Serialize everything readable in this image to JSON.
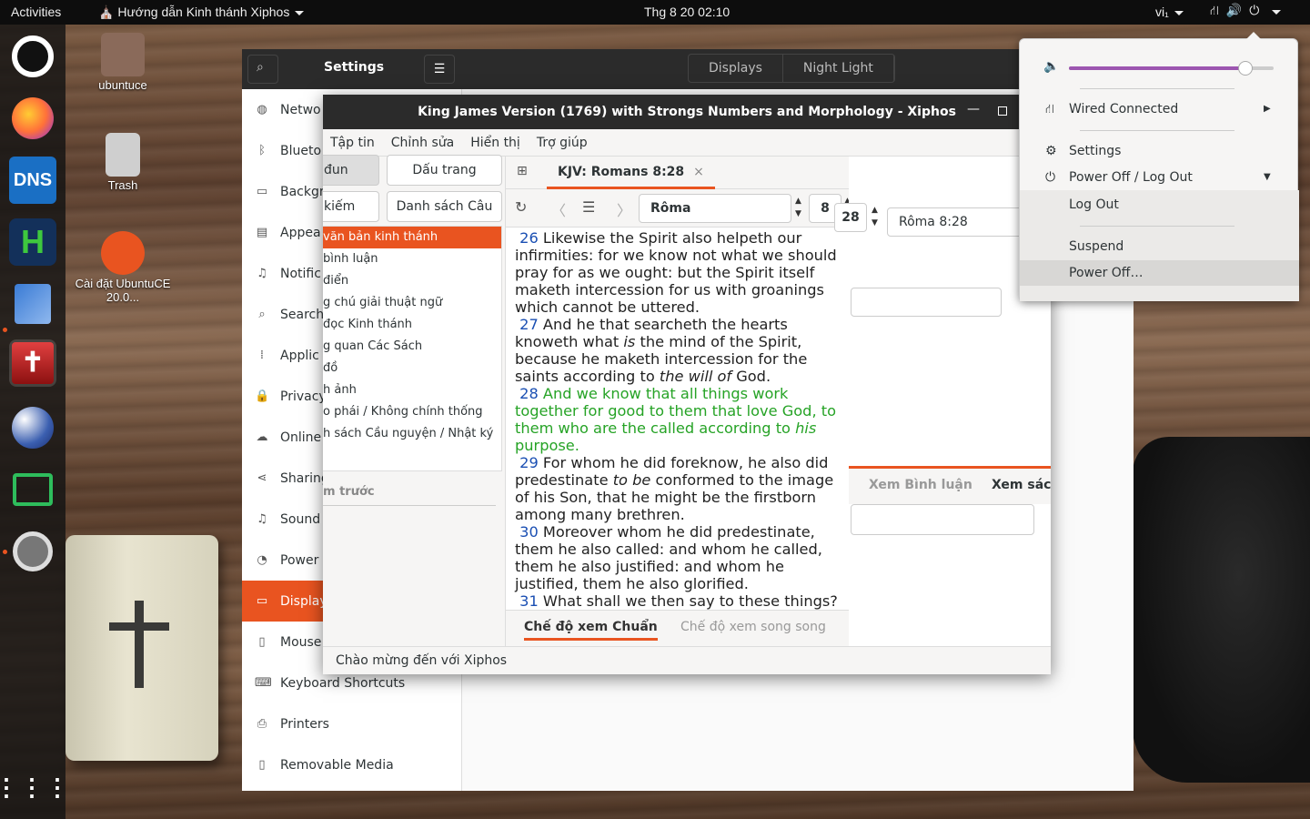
{
  "topbar": {
    "activities": "Activities",
    "app_menu": "Hướng dẫn Kinh thánh Xiphos",
    "clock": "Thg 8 20  02:10",
    "lang": "vi₁"
  },
  "desktop": {
    "icons": [
      {
        "label": "ubuntuce"
      },
      {
        "label": "Trash"
      },
      {
        "label": "Cài đặt UbuntuCE 20.0..."
      }
    ]
  },
  "dock": {
    "items": [
      "ubuntu-icon",
      "firefox-icon",
      "dns-icon",
      "h-icon",
      "installer-icon",
      "xiphos-icon",
      "globe-icon",
      "screen-icon",
      "settings-icon",
      "apps-grid-icon"
    ],
    "dns_label": "DNS",
    "h_label": "H"
  },
  "settings": {
    "title": "Settings",
    "tabs": [
      "Displays",
      "Night Light"
    ],
    "sidebar": [
      {
        "label": "Netwo",
        "icon": "network-icon"
      },
      {
        "label": "Blueto",
        "icon": "bluetooth-icon"
      },
      {
        "label": "Backgr",
        "icon": "background-icon"
      },
      {
        "label": "Appea",
        "icon": "appearance-icon"
      },
      {
        "label": "Notific",
        "icon": "bell-icon"
      },
      {
        "label": "Search",
        "icon": "search-icon"
      },
      {
        "label": "Applic",
        "icon": "apps-icon"
      },
      {
        "label": "Privacy",
        "icon": "lock-icon"
      },
      {
        "label": "Online",
        "icon": "cloud-icon"
      },
      {
        "label": "Sharing",
        "icon": "share-icon"
      },
      {
        "label": "Sound",
        "icon": "music-icon"
      },
      {
        "label": "Power",
        "icon": "power-icon"
      },
      {
        "label": "Display",
        "icon": "display-icon"
      },
      {
        "label": "Mouse",
        "icon": "mouse-icon"
      },
      {
        "label": "Keyboard Shortcuts",
        "icon": "keyboard-icon"
      },
      {
        "label": "Printers",
        "icon": "printer-icon"
      },
      {
        "label": "Removable Media",
        "icon": "media-icon"
      }
    ]
  },
  "xiphos": {
    "title": "King James Version (1769) with Strongs Numbers and Morphology - Xiphos",
    "menu": [
      "Tập tin",
      "Chỉnh sửa",
      "Hiển thị",
      "Trợ giúp"
    ],
    "left": {
      "btn1": "đun",
      "btn2": "Dấu trang",
      "btn3": "kiếm",
      "btn4": "Danh sách Câu",
      "tree": [
        "văn bản kinh thánh",
        "bình luận",
        "điển",
        "g chú giải thuật ngữ",
        " đọc Kinh thánh",
        "g quan Các Sách",
        " đồ",
        "h ảnh",
        "o phái / Không chính thống",
        "h sách Cầu nguyện / Nhật ký"
      ],
      "preview": "m trước"
    },
    "tab_label": "KJV: Romans 8:28",
    "nav": {
      "book": "Rôma",
      "chapter": "8",
      "verse": "28",
      "ref": "Rôma 8:28"
    },
    "verses": [
      {
        "num": "26",
        "pre": "Likewise the Spirit also helpeth our infirmities: for we know not what we should pray for as we ought: but the Spirit itself maketh intercession for us with groanings which cannot be uttered.",
        "highlight": false
      },
      {
        "num": "27",
        "pre": "And he that searcheth the hearts knoweth what ",
        "em": "is",
        "post": " the mind of the Spirit, because he maketh intercession for the saints according to ",
        "em2": "the will of",
        "post2": " God.",
        "highlight": false
      },
      {
        "num": "28",
        "pre": "And we know that all things work together for good to them that love God, to them who are the called according to ",
        "em": "his",
        "post": " purpose.",
        "highlight": true
      },
      {
        "num": "29",
        "pre": "For whom he did foreknow, he also did predestinate ",
        "em": "to be",
        "post": " conformed to the image of his Son, that he might be the firstborn among many brethren.",
        "highlight": false
      },
      {
        "num": "30",
        "pre": "Moreover whom he did predestinate, them he also called: and whom he called, them he also justified: and whom he justified, them he also glorified.",
        "highlight": false
      },
      {
        "num": "31",
        "pre": "What shall we then say to these things?",
        "highlight": false
      }
    ],
    "view_tabs": [
      "Chế độ xem Chuẩn",
      "Chế độ xem song song"
    ],
    "right_tabs": [
      "Xem Bình luận",
      "Xem sách"
    ],
    "status": "Chào mừng đến với Xiphos"
  },
  "popover": {
    "volume_level": 0.86,
    "wired": "Wired Connected",
    "settings": "Settings",
    "power_menu": "Power Off / Log Out",
    "logout": "Log Out",
    "suspend": "Suspend",
    "poweroff": "Power Off…"
  },
  "colors": {
    "accent": "#e95420",
    "slider": "#9c56b0",
    "verse_num": "#1a4fb3",
    "highlight": "#26a326"
  }
}
